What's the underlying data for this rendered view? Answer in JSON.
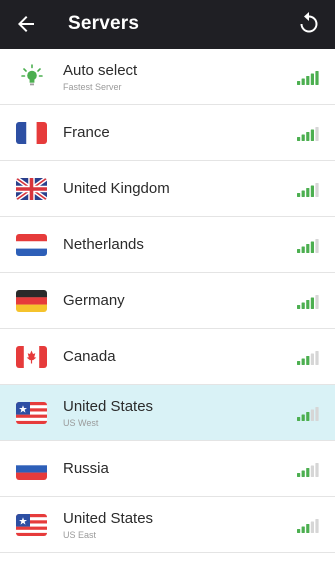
{
  "header": {
    "title": "Servers",
    "back_icon": "arrow-left-icon",
    "refresh_icon": "refresh-icon"
  },
  "colors": {
    "topbar": "#1f1f24",
    "selected_row": "#d9f2f6",
    "signal_on": "#4caf50",
    "signal_off": "#d6d6d6"
  },
  "servers": [
    {
      "name": "Auto select",
      "subtitle": "Fastest Server",
      "icon": "lightbulb-icon",
      "signal": 5,
      "selected": false
    },
    {
      "name": "France",
      "subtitle": "",
      "icon": "flag-france-icon",
      "signal": 4,
      "selected": false
    },
    {
      "name": "United Kingdom",
      "subtitle": "",
      "icon": "flag-uk-icon",
      "signal": 4,
      "selected": false
    },
    {
      "name": "Netherlands",
      "subtitle": "",
      "icon": "flag-netherlands-icon",
      "signal": 4,
      "selected": false
    },
    {
      "name": "Germany",
      "subtitle": "",
      "icon": "flag-germany-icon",
      "signal": 4,
      "selected": false
    },
    {
      "name": "Canada",
      "subtitle": "",
      "icon": "flag-canada-icon",
      "signal": 3,
      "selected": false
    },
    {
      "name": "United States",
      "subtitle": "US West",
      "icon": "flag-usa-icon",
      "signal": 3,
      "selected": true
    },
    {
      "name": "Russia",
      "subtitle": "",
      "icon": "flag-russia-icon",
      "signal": 3,
      "selected": false
    },
    {
      "name": "United States",
      "subtitle": "US East",
      "icon": "flag-usa-icon",
      "signal": 3,
      "selected": false
    }
  ]
}
